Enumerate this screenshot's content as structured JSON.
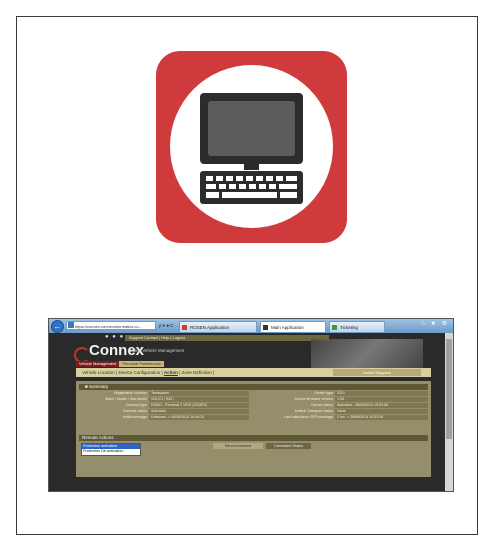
{
  "icons": {
    "app": "laptop-icon",
    "colors": {
      "tile": "#cf3a3c",
      "disc": "#ffffff",
      "device": "#2c2c2c",
      "screen": "#5c5c5c"
    }
  },
  "browser": {
    "address": "https://connex.connexinformatics.co...",
    "address_controls": "ρ ▾ ● C",
    "tabs": [
      {
        "label": "ROSEN Application",
        "active": false
      },
      {
        "label": "Main Application",
        "active": true
      },
      {
        "label": "Ticketing",
        "active": false
      }
    ],
    "window_controls": "⌂ ★ ⚙"
  },
  "app": {
    "top_menu": "Support Contact | Help | Logout",
    "dots": "● ● ●",
    "logo_text": "Connex",
    "logo_sub": "Online Vehicle Management",
    "nav_tabs": [
      "Vehicle Management",
      "Personal Preferences"
    ],
    "sub_nav": {
      "items": [
        "Vehicle Location",
        "Device Configuration",
        "Action",
        "Zone Definition"
      ],
      "active": "Action"
    },
    "region": "United Kingdom",
    "summary": {
      "title": "Summary",
      "left": [
        {
          "label": "Registration Number",
          "value": "Testsystem"
        },
        {
          "label": "Make / Model / Sub Model",
          "value": "VOLVO / 940 /"
        },
        {
          "label": "Contract type",
          "value": "DEMO - Personal 3 VEIS (2016P2)"
        },
        {
          "label": "Contract status",
          "value": "Activated"
        },
        {
          "label": "Initial message",
          "value": "Unknown -> 04/06/2014 14:40:23"
        }
      ],
      "right": [
        {
          "label": "Device type",
          "value": "2221"
        },
        {
          "label": "Device firmware version",
          "value": "1.06"
        },
        {
          "label": "Device status",
          "value": "Activated - 28/06/2014 15:53:06"
        },
        {
          "label": "Default Transport status",
          "value": "None"
        },
        {
          "label": "Last calculation GPS message",
          "value": "0 km -> 28/06/2014 10:33:34"
        }
      ]
    },
    "remote_actions": {
      "title": "Remote Actions",
      "options": [
        "Protection activation",
        "Protection De-activation"
      ],
      "selected_index": 0,
      "send_button": "Send command",
      "status_label": "Command Status"
    }
  }
}
